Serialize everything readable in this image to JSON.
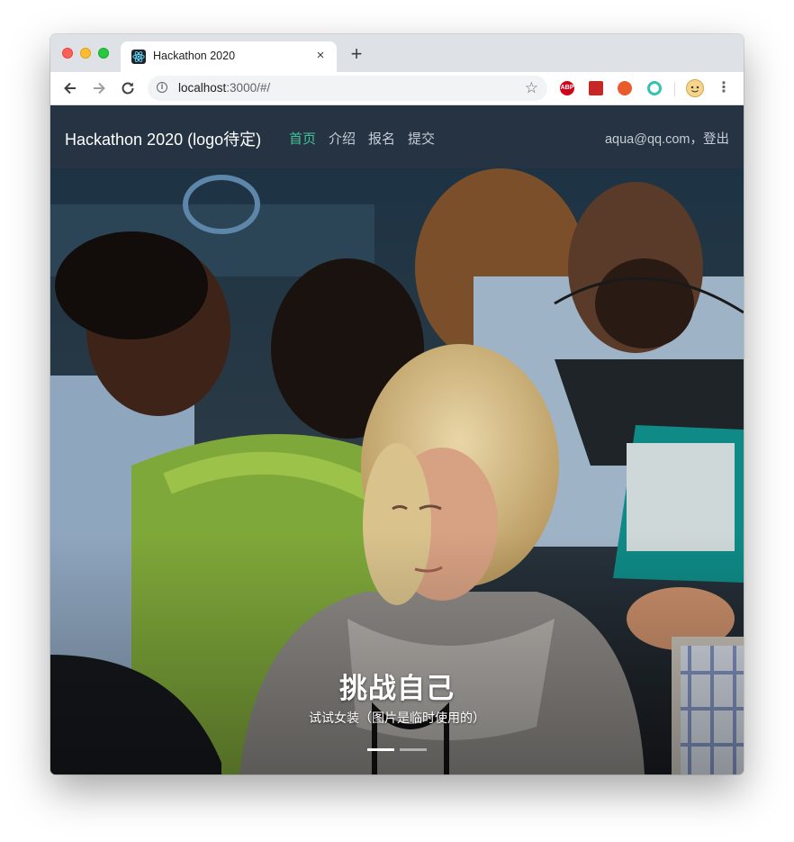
{
  "browser": {
    "tab_title": "Hackathon 2020",
    "tab_close": "×",
    "new_tab": "+",
    "url_host": "localhost",
    "url_rest": ":3000/#/",
    "extensions": [
      "ABP",
      "",
      "",
      ""
    ]
  },
  "navbar": {
    "brand": "Hackathon 2020 (logo待定)",
    "links": [
      {
        "label": "首页",
        "active": true
      },
      {
        "label": "介绍",
        "active": false
      },
      {
        "label": "报名",
        "active": false
      },
      {
        "label": "提交",
        "active": false
      }
    ],
    "user_email": "aqua@qq.com",
    "separator": "，",
    "logout": "登出",
    "active_color": "#41c39a"
  },
  "hero": {
    "caption_title": "挑战自己",
    "caption_subtitle": "试试女装（图片是临时使用的）",
    "slide_count": 2,
    "active_slide": 1
  },
  "icons": {
    "back": "back-arrow-icon",
    "forward": "forward-arrow-icon",
    "reload": "reload-icon",
    "info": "info-icon",
    "bookmark": "star-icon",
    "menu": "three-dots-icon"
  }
}
